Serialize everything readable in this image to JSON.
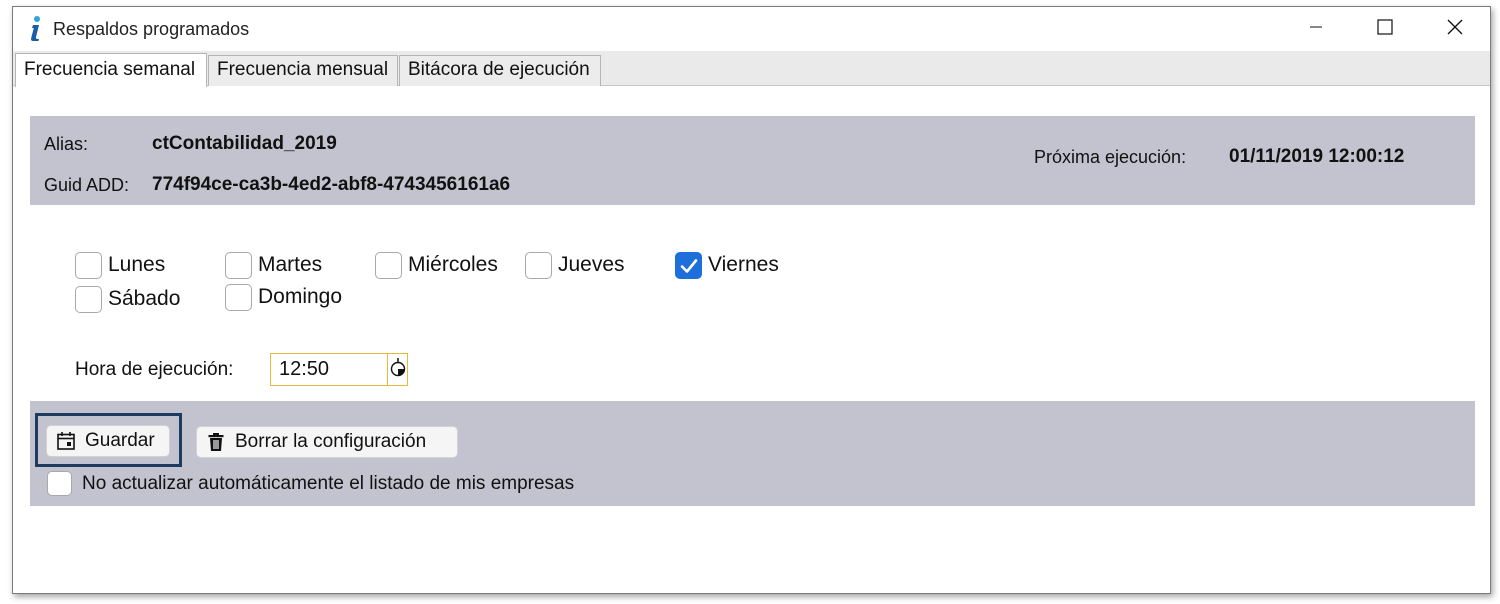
{
  "window": {
    "title": "Respaldos programados",
    "controls": {
      "minimize": "minimize-icon",
      "maximize": "maximize-icon",
      "close": "close-icon"
    }
  },
  "tabs": [
    {
      "label": "Frecuencia semanal",
      "active": true
    },
    {
      "label": "Frecuencia mensual",
      "active": false
    },
    {
      "label": "Bitácora de ejecución",
      "active": false
    }
  ],
  "info": {
    "alias_label": "Alias:",
    "alias_value": "ctContabilidad_2019",
    "guid_label": "Guid ADD:",
    "guid_value": "774f94ce-ca3b-4ed2-abf8-4743456161a6",
    "next_label": "Próxima ejecución:",
    "next_value": "01/11/2019 12:00:12"
  },
  "days": [
    {
      "label": "Lunes",
      "checked": false
    },
    {
      "label": "Martes",
      "checked": false
    },
    {
      "label": "Miércoles",
      "checked": false
    },
    {
      "label": "Jueves",
      "checked": false
    },
    {
      "label": "Viernes",
      "checked": true
    },
    {
      "label": "Sábado",
      "checked": false
    },
    {
      "label": "Domingo",
      "checked": false
    }
  ],
  "schedule": {
    "hora_label": "Hora de ejecución:",
    "hora_value": "12:50"
  },
  "actions": {
    "guardar_label": "Guardar",
    "borrar_label": "Borrar la configuración",
    "no_actualizar_label": "No actualizar automáticamente el listado de mis empresas",
    "no_actualizar_checked": false
  },
  "colors": {
    "panel": "#c3c3cf",
    "check_accent": "#1e6fd9",
    "focus_border": "#1f3b5e",
    "time_border": "#e7b93a"
  }
}
